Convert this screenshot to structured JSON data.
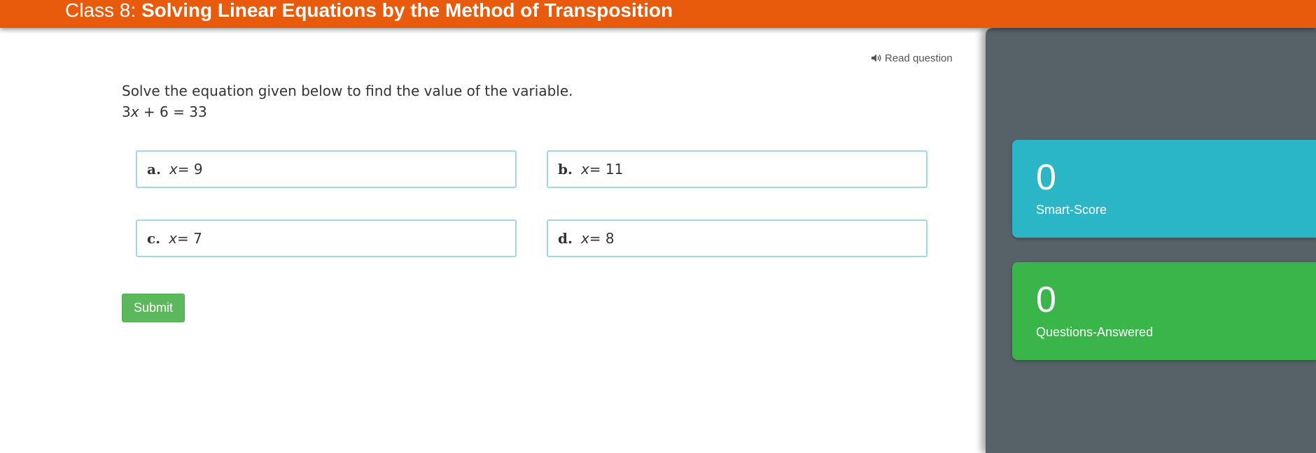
{
  "header": {
    "prefix": "Class 8:",
    "topic": "Solving Linear Equations by the Method of Transposition",
    "background_color": "#e85b0c"
  },
  "read_question": {
    "label": "Read question",
    "icon": "speaker-icon"
  },
  "question": {
    "prompt": "Solve the equation given below to find the value of the variable.",
    "equation": {
      "coefficient": "3",
      "variable": "x",
      "rest": " + 6 = 33"
    }
  },
  "options": [
    {
      "letter": "a.",
      "variable": "x",
      "rest": " = 9"
    },
    {
      "letter": "b.",
      "variable": "x",
      "rest": " = 11"
    },
    {
      "letter": "c.",
      "variable": "x",
      "rest": " = 7"
    },
    {
      "letter": "d.",
      "variable": "x",
      "rest": " = 8"
    }
  ],
  "submit": {
    "label": "Submit",
    "color": "#5cb85c"
  },
  "sidebar": {
    "background_color": "#566168",
    "smart_score": {
      "value": "0",
      "label": "Smart-Score",
      "color": "#2ab6c6"
    },
    "questions_answered": {
      "value": "0",
      "label": "Questions-Answered",
      "color": "#39b54a"
    }
  }
}
